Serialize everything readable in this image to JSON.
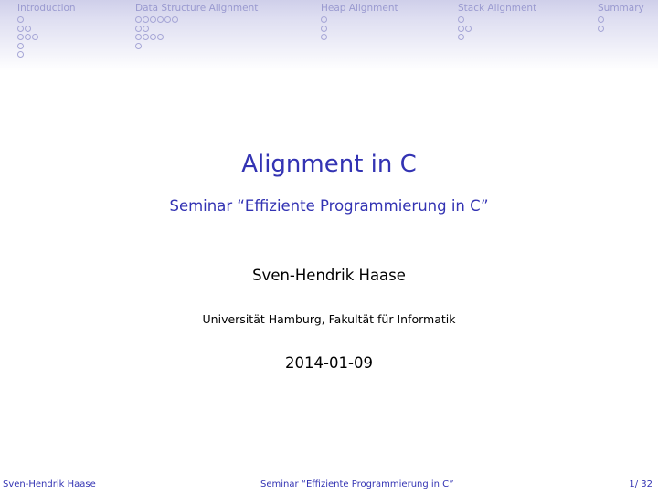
{
  "headline": {
    "sections": [
      {
        "label": "Introduction",
        "subsections": [
          1,
          2,
          3,
          1,
          1
        ]
      },
      {
        "label": "Data Structure Alignment",
        "subsections": [
          6,
          2,
          4,
          1
        ]
      },
      {
        "label": "Heap Alignment",
        "subsections": [
          1,
          1,
          1
        ]
      },
      {
        "label": "Stack Alignment",
        "subsections": [
          1,
          2,
          1
        ]
      },
      {
        "label": "Summary",
        "subsections": [
          1,
          1
        ]
      }
    ]
  },
  "slide": {
    "title": "Alignment in C",
    "subtitle": "Seminar “Effiziente Programmierung in C”",
    "author": "Sven-Hendrik Haase",
    "institute": "Universität Hamburg, Fakultät für Informatik",
    "date": "2014-01-09"
  },
  "footline": {
    "author": "Sven-Hendrik Haase",
    "title": "Seminar “Effiziente Programmierung in C”",
    "page": "1/ 32"
  },
  "colors": {
    "accent": "#3333b3",
    "headline_text": "#9a9ad0",
    "headline_bg": "#cfcfea"
  }
}
